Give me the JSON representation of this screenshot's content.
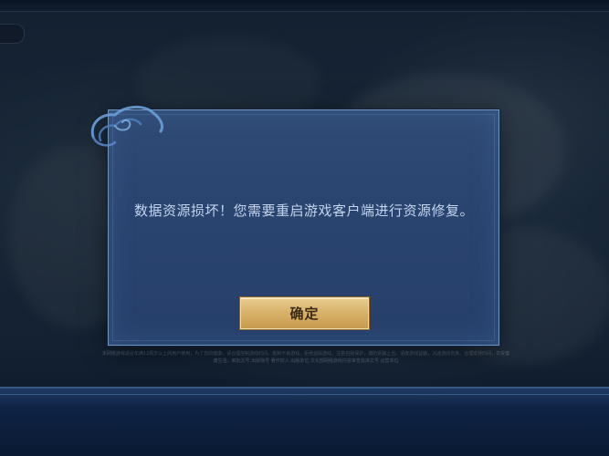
{
  "dialog": {
    "message": "数据资源损坏！您需要重启游戏客户端进行资源修复。",
    "confirm_label": "确定"
  },
  "legal_notice": "本网络游戏适合年满12周岁以上的用户使用；为了您的健康，请合理控制游戏时间。抵制不良游戏，拒绝盗版游戏。注意自我保护，谨防受骗上当。适度游戏益脑，沉迷游戏伤身。合理安排时间，享受健康生活。审批文号 出版物号 著作权人 出版单位 文化部网络游戏内容审查批准文号 运营单位",
  "colors": {
    "dialog_bg": "#2a4470",
    "dialog_border": "#6f92bf",
    "message_text": "#c3d5ee",
    "button_gold": "#d9b36b",
    "button_text": "#3b2a14"
  },
  "icons": {
    "back_tab": "back-tab-icon",
    "swirl": "cloud-swirl-ornament"
  }
}
